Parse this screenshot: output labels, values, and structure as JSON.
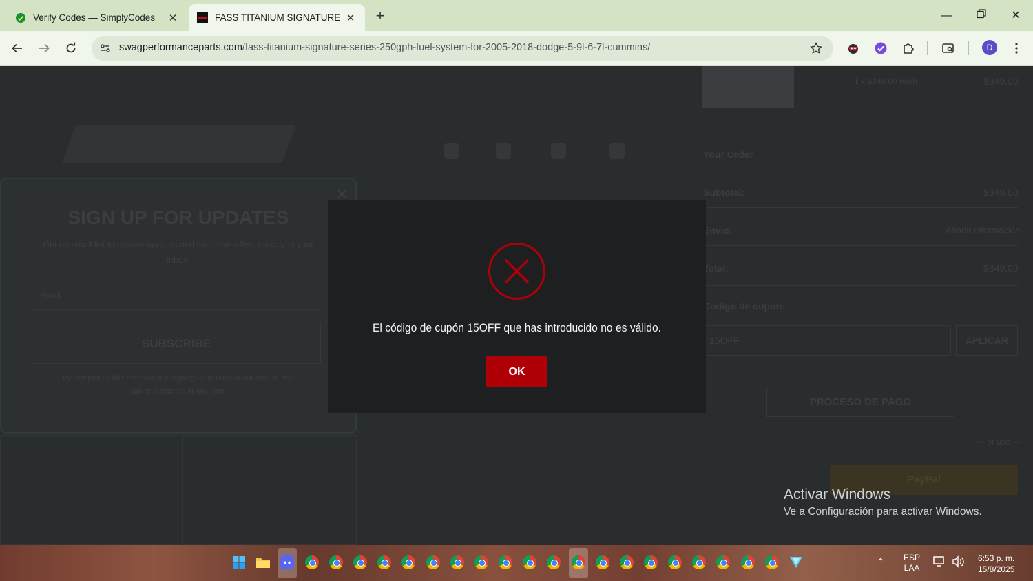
{
  "browser": {
    "tabs": [
      {
        "title": "Verify Codes — SimplyCodes",
        "active": false
      },
      {
        "title": "FASS TITANIUM SIGNATURE SERIES",
        "active": true
      }
    ],
    "url_domain": "swagperformanceparts.com",
    "url_path": "/fass-titanium-signature-series-250gph-fuel-system-for-2005-2018-dodge-5-9l-6-7l-cummins/",
    "profile_initial": "D"
  },
  "page": {
    "signup": {
      "title": "SIGN UP FOR UPDATES",
      "subtitle": "Get on email list to receive updates and exclusive offers directly in your inbox.",
      "email_placeholder": "Email",
      "subscribe_label": "SUBSCRIBE",
      "disclaimer": "By completing this form you are signing up to receive our emails. You can unsubscribe at any time."
    },
    "cart": {
      "item_price_line": "1 x $849.00 each",
      "item_total": "$849.00",
      "your_order": "Your Order",
      "subtotal_label": "Subtotal:",
      "subtotal_value": "$849.00",
      "shipping_label": "Envío:",
      "shipping_value": "Añadir información",
      "total_label": "Total:",
      "total_value": "$849.00",
      "coupon_label": "Código de cupón:",
      "coupon_value": "15OFF",
      "apply_label": "APLICAR",
      "checkout_label": "PROCESO DE PAGO",
      "or_use": "— or use —",
      "paypal_label": "PayPal"
    }
  },
  "modal": {
    "message": "El código de cupón 15OFF que has introducido no es válido.",
    "ok_label": "OK",
    "icon": "error-x-icon",
    "accent": "#b00007"
  },
  "watermark": {
    "line1": "Activar Windows",
    "line2": "Ve a Configuración para activar Windows."
  },
  "taskbar": {
    "lang_line1": "ESP",
    "lang_line2": "LAA",
    "time": "6:53 p. m.",
    "date": "15/8/2025"
  }
}
